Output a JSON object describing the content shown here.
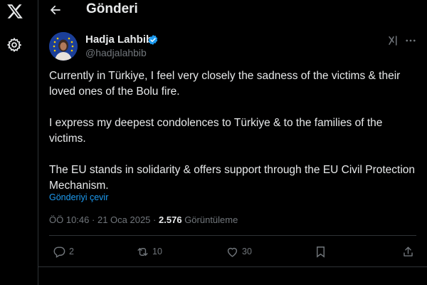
{
  "nav": {
    "logo_icon": "x-logo-icon",
    "settings_icon": "gear-icon"
  },
  "header": {
    "back_icon": "arrow-left-icon",
    "title": "Gönderi"
  },
  "post": {
    "author_name": "Hadja Lahbib",
    "handle": "@hadjalahbib",
    "verified": true,
    "paragraphs": [
      "Currently in Türkiye, I feel very closely the sadness of the victims & their loved ones of the Bolu fire.",
      "I express my deepest condolences to Türkiye & to the families of the victims.",
      "The EU stands in solidarity & offers support through the EU Civil Protection Mechanism."
    ],
    "translate_label": "Gönderiyi çevir",
    "time": "ÖÖ 10:46",
    "separator": "·",
    "date": "21 Oca 2025",
    "views_count": "2.576",
    "views_label": "Görüntüleme"
  },
  "actions": {
    "replies": "2",
    "reposts": "10",
    "likes": "30"
  },
  "colors": {
    "background": "#000000",
    "text": "#e7e9ea",
    "muted": "#71767b",
    "accent": "#1d9bf0",
    "border": "#2f3336"
  }
}
